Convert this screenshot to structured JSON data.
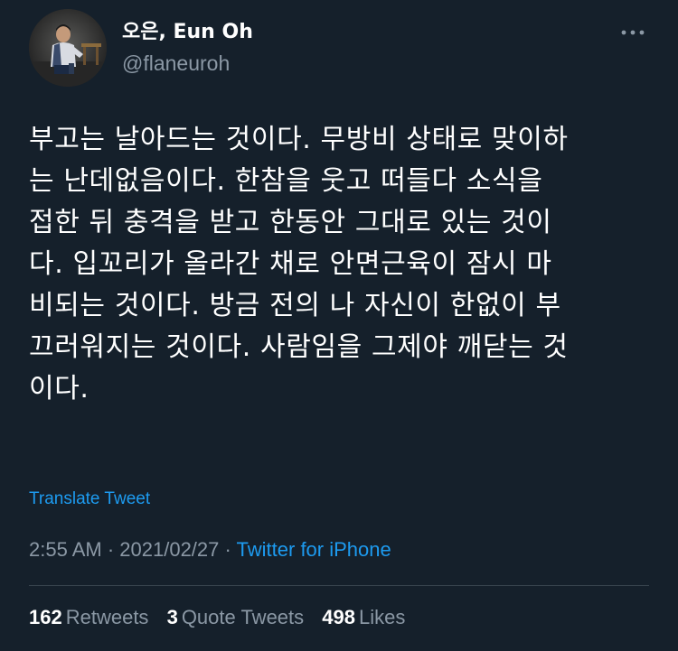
{
  "author": {
    "display_name": "오은, Eun Oh",
    "handle": "@flaneuroh"
  },
  "tweet": {
    "lines": [
      "부고는 날아드는 것이다. 무방비 상태로 맞이하",
      "는 난데없음이다. 한참을 웃고 떠들다 소식을",
      "접한 뒤 충격을 받고 한동안 그대로 있는 것이",
      "다. 입꼬리가 올라간 채로 안면근육이 잠시 마",
      "비되는 것이다. 방금 전의 나 자신이 한없이 부",
      "끄러워지는 것이다. 사람임을 그제야 깨닫는 것",
      "이다."
    ],
    "translate_label": "Translate Tweet"
  },
  "meta": {
    "time": "2:55 AM",
    "separator": " · ",
    "date": "2021/02/27",
    "source": "Twitter for iPhone"
  },
  "stats": {
    "retweets_count": "162",
    "retweets_label": "Retweets",
    "quotes_count": "3",
    "quotes_label": "Quote Tweets",
    "likes_count": "498",
    "likes_label": "Likes"
  },
  "icons": {
    "more": "more-horizontal-icon"
  },
  "colors": {
    "background": "#15202b",
    "text": "#ffffff",
    "secondary": "#8b98a5",
    "link": "#1d9bf0",
    "divider": "#38444d"
  }
}
